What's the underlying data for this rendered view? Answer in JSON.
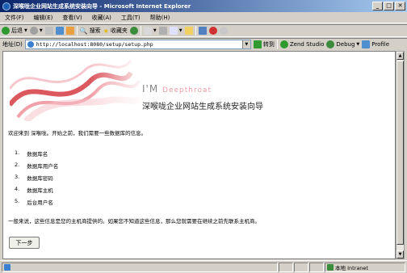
{
  "window": {
    "title": "深喉咙企业网站生成系统安装向导 - Microsoft Internet Explorer",
    "controls": [
      "_",
      "□",
      "✕"
    ]
  },
  "menu": [
    "文件(F)",
    "编辑(E)",
    "查看(V)",
    "收藏(A)",
    "工具(T)",
    "帮助(H)"
  ],
  "toolbar": {
    "back": "后退",
    "search": "搜索",
    "favorites": "收藏夹"
  },
  "address": {
    "label": "地址(D)",
    "url": "http://localhost:8080/setup/setup.php",
    "go": "转到",
    "zend": "Zend Studio",
    "debug": "Debug",
    "profile": "Profile"
  },
  "page": {
    "brand_main": "I'M",
    "brand_sub": "Deepthroat",
    "title": "深喉咙企业网站生成系统安装向导",
    "welcome": "欢迎来到 深喉咙。开始之前，我们需要一些数据库的信息。",
    "steps": [
      {
        "num": "1.",
        "label": "数据库名"
      },
      {
        "num": "2.",
        "label": "数据库用户名"
      },
      {
        "num": "3.",
        "label": "数据库密码"
      },
      {
        "num": "4.",
        "label": "数据库主机"
      },
      {
        "num": "5.",
        "label": "后台用户名"
      }
    ],
    "notice": "一般来说，这些信息是您的主机商提供的。如果您不知道这些信息，那么您就需要在继续之前先联系主机商。",
    "next_button": "下一步"
  },
  "status": {
    "zone": "本地 Intranet"
  },
  "colors": {
    "title_bar": "#0a246a",
    "banner_red": "#d0202a",
    "brand_pink": "#f0a0a8"
  }
}
